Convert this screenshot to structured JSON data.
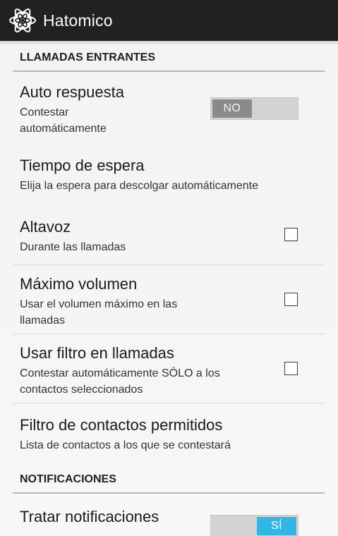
{
  "app_bar": {
    "title": "Hatomico",
    "icon": "atom-icon"
  },
  "sections": {
    "incoming_calls": {
      "header": "LLAMADAS ENTRANTES"
    },
    "notifications": {
      "header": "NOTIFICACIONES"
    }
  },
  "prefs": {
    "auto_answer": {
      "title": "Auto respuesta",
      "summary_line1": "Contestar",
      "summary_line2": "automáticamente",
      "switch_label": "NO",
      "checked": false
    },
    "wait_time": {
      "title": "Tiempo de espera",
      "summary": "Elija la espera para descolgar automáticamente"
    },
    "speaker": {
      "title": "Altavoz",
      "summary": "Durante las llamadas",
      "checked": false
    },
    "max_volume": {
      "title": "Máximo volumen",
      "summary_line1": "Usar el volumen máximo en las",
      "summary_line2": "llamadas",
      "checked": false
    },
    "call_filter": {
      "title": "Usar filtro en llamadas",
      "summary_line1": "Contestar automáticamente SÓLO a los",
      "summary_line2": "contactos seleccionados",
      "checked": false
    },
    "allowed_contacts": {
      "title": "Filtro de contactos permitidos",
      "summary": "Lista de contactos a los que se contestará"
    },
    "handle_notifications": {
      "title": "Tratar notificaciones",
      "switch_label": "SÍ",
      "checked": true
    }
  },
  "colors": {
    "action_bar": "#212121",
    "switch_on": "#33b5e5",
    "switch_off_thumb": "#8a8a8a",
    "background": "#f3f3f3"
  }
}
